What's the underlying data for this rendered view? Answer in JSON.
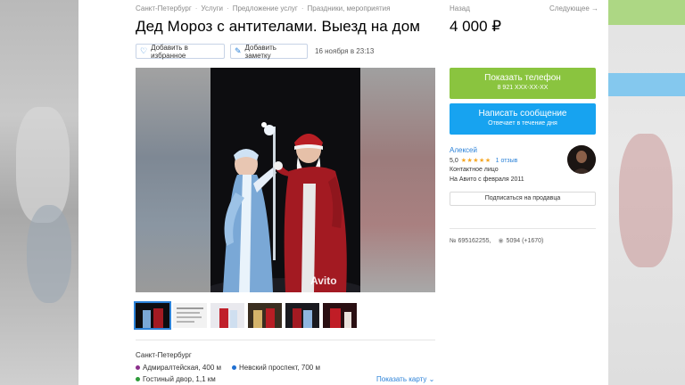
{
  "breadcrumb": [
    "Санкт-Петербург",
    "Услуги",
    "Предложение услуг",
    "Праздники, мероприятия"
  ],
  "nav": {
    "back": "Назад",
    "next": "Следующее →"
  },
  "listing": {
    "title": "Дед Мороз с антителами. Выезд на дом",
    "price": "4 000 ₽",
    "add_favorite": "Добавить в избранное",
    "add_note": "Добавить заметку",
    "date": "16 ноября в 23:13",
    "watermark": "Avito",
    "thumbnail_count": 6
  },
  "location": {
    "city": "Санкт-Петербург",
    "metro": [
      {
        "name": "Адмиралтейская, 400 м",
        "color": "#8b2f8b"
      },
      {
        "name": "Невский проспект, 700 м",
        "color": "#1f6fd1"
      },
      {
        "name": "Гостиный двор, 1,1 км",
        "color": "#2e9b3a"
      }
    ],
    "show_map": "Показать карту"
  },
  "contact": {
    "phone_label": "Показать телефон",
    "phone_masked": "8 921 XXX-XX-XX",
    "message_label": "Написать сообщение",
    "message_sub": "Отвечает в течение дня"
  },
  "seller": {
    "name": "Алексей",
    "rating": "5,0",
    "stars": "★★★★★",
    "reviews": "1 отзыв",
    "type": "Контактное лицо",
    "since": "На Авито с февраля 2011",
    "subscribe": "Подписаться на продавца"
  },
  "meta": {
    "item_number": "№ 695162255,",
    "views": "5094 (+1670)"
  },
  "colors": {
    "phone_button": "#8ac43f",
    "message_button": "#17a3f0",
    "link": "#2c82d8",
    "star": "#f5a623"
  }
}
